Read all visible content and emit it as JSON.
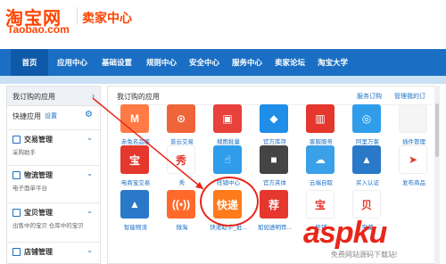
{
  "header": {
    "logo_main": "淘宝网",
    "logo_sub": "Taobao.com",
    "center_title": "卖家中心"
  },
  "nav": {
    "items": [
      "首页",
      "应用中心",
      "基础设置",
      "规则中心",
      "安全中心",
      "服务中心",
      "卖家论坛",
      "淘宝大学"
    ]
  },
  "sidebar": {
    "my_apps": "我订购的应用",
    "quick_label": "快捷应用",
    "quick_settings": "设置",
    "groups": [
      {
        "title": "交易管理",
        "sub": "采购助手"
      },
      {
        "title": "物流管理",
        "sub": "电子面单平台"
      },
      {
        "title": "宝贝管理",
        "sub": "出售中的宝贝    仓库中的宝贝"
      },
      {
        "title": "店铺管理",
        "sub": ""
      }
    ]
  },
  "main": {
    "title": "我订购的应用",
    "link_service": "服务订购",
    "link_manage": "管理我的订",
    "apps": [
      {
        "label": "赤兔名品客",
        "color": "#ff7a45",
        "glyph": "M"
      },
      {
        "label": "普云交易",
        "color": "#f0643a",
        "glyph": "⊙"
      },
      {
        "label": "搜图批量",
        "color": "#e8403a",
        "glyph": "▣"
      },
      {
        "label": "官方库存",
        "color": "#1f8ee8",
        "glyph": "◆"
      },
      {
        "label": "客服服务",
        "color": "#e5372d",
        "glyph": "▥"
      },
      {
        "label": "阿里万客",
        "color": "#2f9de9",
        "glyph": "◎"
      },
      {
        "label": "插件管理",
        "color": "#f5f5f5",
        "glyph": ""
      },
      {
        "label": "电商宝交易",
        "color": "#e5372d",
        "glyph": "宝"
      },
      {
        "label": "秀",
        "color": "#fff",
        "glyph": "秀"
      },
      {
        "label": "旺铺中心",
        "color": "#2f9de9",
        "glyph": "☝"
      },
      {
        "label": "官方夹体",
        "color": "#444",
        "glyph": "■"
      },
      {
        "label": "云端自取",
        "color": "#3aa0e8",
        "glyph": "☁"
      },
      {
        "label": "买入认证",
        "color": "#2a79c9",
        "glyph": "▲"
      },
      {
        "label": "发布商品",
        "color": "#fff",
        "glyph": "➤"
      },
      {
        "label": "智能物流",
        "color": "#2a79c9",
        "glyph": "▲"
      },
      {
        "label": "微淘",
        "color": "#ff6a2b",
        "glyph": "((•))"
      },
      {
        "label": "快递助手_批...",
        "color": "#ff7a1a",
        "glyph": "快递"
      },
      {
        "label": "如如透明荐...",
        "color": "#e5372d",
        "glyph": "荐"
      },
      {
        "label": "旺铺",
        "color": "#fff",
        "glyph": "宝"
      },
      {
        "label": "宝藏",
        "color": "#fff",
        "glyph": "贝"
      }
    ]
  },
  "watermark": {
    "main": "aspku",
    "sub": "免费网站源码下载站!"
  }
}
